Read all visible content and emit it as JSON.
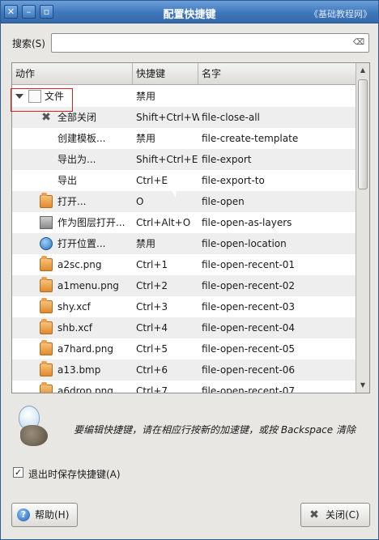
{
  "window": {
    "title": "配置快捷键",
    "watermark": "《基础教程网》",
    "buttons": {
      "close": "✕",
      "minimize": "–",
      "maximize": "▫"
    }
  },
  "search": {
    "label": "搜索(S)",
    "value": "",
    "clear_icon": "⌫"
  },
  "tree": {
    "headers": {
      "action": "动作",
      "shortcut": "快捷键",
      "name": "名字"
    },
    "rows": [
      {
        "indent": 0,
        "icon": "document-icon",
        "expand": true,
        "action": "文件",
        "shortcut": "禁用",
        "name": ""
      },
      {
        "indent": 1,
        "icon": "x-icon",
        "action": "全部关闭",
        "shortcut": "Shift+Ctrl+W",
        "name": "file-close-all"
      },
      {
        "indent": 1,
        "icon": "",
        "action": "创建模板...",
        "shortcut": "禁用",
        "name": "file-create-template"
      },
      {
        "indent": 1,
        "icon": "",
        "action": "导出为...",
        "shortcut": "Shift+Ctrl+E",
        "name": "file-export"
      },
      {
        "indent": 1,
        "icon": "",
        "action": "导出",
        "shortcut": "Ctrl+E",
        "name": "file-export-to"
      },
      {
        "indent": 1,
        "icon": "folder-icon",
        "action": "打开...",
        "shortcut": "O",
        "name": "file-open"
      },
      {
        "indent": 1,
        "icon": "layers-icon",
        "action": "作为图层打开...",
        "shortcut": "Ctrl+Alt+O",
        "name": "file-open-as-layers"
      },
      {
        "indent": 1,
        "icon": "globe-icon",
        "action": "打开位置...",
        "shortcut": "禁用",
        "name": "file-open-location"
      },
      {
        "indent": 1,
        "icon": "folder-icon",
        "action": "a2sc.png",
        "shortcut": "Ctrl+1",
        "name": "file-open-recent-01"
      },
      {
        "indent": 1,
        "icon": "folder-icon",
        "action": "a1menu.png",
        "shortcut": "Ctrl+2",
        "name": "file-open-recent-02"
      },
      {
        "indent": 1,
        "icon": "folder-icon",
        "action": "shy.xcf",
        "shortcut": "Ctrl+3",
        "name": "file-open-recent-03"
      },
      {
        "indent": 1,
        "icon": "folder-icon",
        "action": "shb.xcf",
        "shortcut": "Ctrl+4",
        "name": "file-open-recent-04"
      },
      {
        "indent": 1,
        "icon": "folder-icon",
        "action": "a7hard.png",
        "shortcut": "Ctrl+5",
        "name": "file-open-recent-05"
      },
      {
        "indent": 1,
        "icon": "folder-icon",
        "action": "a13.bmp",
        "shortcut": "Ctrl+6",
        "name": "file-open-recent-06"
      },
      {
        "indent": 1,
        "icon": "folder-icon",
        "action": "a6drop.png",
        "shortcut": "Ctrl+7",
        "name": "file-open-recent-07"
      }
    ]
  },
  "hint": {
    "text": "要编辑快捷键，请在相应行按新的加速键，或按 Backspace 清除"
  },
  "save_on_exit": {
    "label": "退出时保存快捷键(A)",
    "checked": true,
    "check_glyph": "✓"
  },
  "buttons": {
    "help": "帮助(H)",
    "close": "关闭(C)",
    "help_glyph": "?",
    "close_glyph": "✖"
  }
}
